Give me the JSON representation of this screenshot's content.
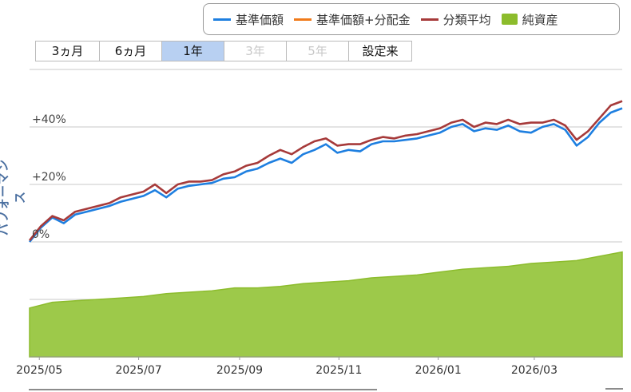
{
  "legend": {
    "items": [
      {
        "label": "基準価額",
        "color": "#1e7fe0",
        "kind": "line"
      },
      {
        "label": "基準価額+分配金",
        "color": "#f07a1a",
        "kind": "line"
      },
      {
        "label": "分類平均",
        "color": "#a63a3a",
        "kind": "line"
      },
      {
        "label": "純資産",
        "color": "#8cbc2c",
        "kind": "box"
      }
    ]
  },
  "range_buttons": [
    {
      "label": "3ヵ月",
      "state": "normal"
    },
    {
      "label": "6ヵ月",
      "state": "normal"
    },
    {
      "label": "1年",
      "state": "active"
    },
    {
      "label": "3年",
      "state": "disabled"
    },
    {
      "label": "5年",
      "state": "disabled"
    },
    {
      "label": "設定来",
      "state": "normal"
    }
  ],
  "y_axis_title": "パフォーマンス",
  "chart_data": {
    "type": "line",
    "x_start": "2025-04-25",
    "x_end": "2026-04-24",
    "x_ticks": [
      "2025/05",
      "2025/07",
      "2025/09",
      "2025/11",
      "2026/01",
      "2026/03"
    ],
    "y_ticks": [
      "0%",
      "+20%",
      "+40%"
    ],
    "ylim": [
      -40,
      60
    ],
    "grid": true,
    "series": [
      {
        "name": "基準価額",
        "color": "#1e7fe0",
        "x": [
          "2025-04-25",
          "2025-05-02",
          "2025-05-09",
          "2025-05-16",
          "2025-05-23",
          "2025-05-30",
          "2025-06-06",
          "2025-06-13",
          "2025-06-20",
          "2025-06-27",
          "2025-07-04",
          "2025-07-11",
          "2025-07-18",
          "2025-07-25",
          "2025-08-01",
          "2025-08-08",
          "2025-08-15",
          "2025-08-22",
          "2025-08-29",
          "2025-09-05",
          "2025-09-12",
          "2025-09-19",
          "2025-09-26",
          "2025-10-03",
          "2025-10-10",
          "2025-10-17",
          "2025-10-24",
          "2025-10-31",
          "2025-11-07",
          "2025-11-14",
          "2025-11-21",
          "2025-11-28",
          "2025-12-05",
          "2025-12-12",
          "2025-12-19",
          "2025-12-26",
          "2026-01-02",
          "2026-01-09",
          "2026-01-16",
          "2026-01-23",
          "2026-01-30",
          "2026-02-06",
          "2026-02-13",
          "2026-02-20",
          "2026-02-27",
          "2026-03-06",
          "2026-03-13",
          "2026-03-20",
          "2026-03-27",
          "2026-04-03",
          "2026-04-10",
          "2026-04-17",
          "2026-04-24"
        ],
        "y": [
          0.0,
          5.0,
          8.5,
          6.5,
          9.5,
          10.5,
          11.5,
          12.5,
          14.0,
          15.0,
          16.0,
          18.0,
          15.5,
          18.5,
          19.5,
          20.0,
          20.5,
          22.0,
          22.5,
          24.5,
          25.5,
          27.5,
          29.0,
          27.5,
          30.5,
          32.0,
          34.0,
          31.0,
          32.0,
          31.5,
          34.0,
          35.0,
          35.0,
          35.5,
          36.0,
          37.0,
          38.0,
          40.0,
          41.0,
          38.5,
          39.5,
          39.0,
          40.5,
          38.5,
          38.0,
          40.0,
          41.0,
          39.0,
          33.5,
          36.5,
          41.5,
          45.0,
          46.5
        ]
      },
      {
        "name": "分類平均",
        "color": "#a63a3a",
        "x": [
          "2025-04-25",
          "2025-05-02",
          "2025-05-09",
          "2025-05-16",
          "2025-05-23",
          "2025-05-30",
          "2025-06-06",
          "2025-06-13",
          "2025-06-20",
          "2025-06-27",
          "2025-07-04",
          "2025-07-11",
          "2025-07-18",
          "2025-07-25",
          "2025-08-01",
          "2025-08-08",
          "2025-08-15",
          "2025-08-22",
          "2025-08-29",
          "2025-09-05",
          "2025-09-12",
          "2025-09-19",
          "2025-09-26",
          "2025-10-03",
          "2025-10-10",
          "2025-10-17",
          "2025-10-24",
          "2025-10-31",
          "2025-11-07",
          "2025-11-14",
          "2025-11-21",
          "2025-11-28",
          "2025-12-05",
          "2025-12-12",
          "2025-12-19",
          "2025-12-26",
          "2026-01-02",
          "2026-01-09",
          "2026-01-16",
          "2026-01-23",
          "2026-01-30",
          "2026-02-06",
          "2026-02-13",
          "2026-02-20",
          "2026-02-27",
          "2026-03-06",
          "2026-03-13",
          "2026-03-20",
          "2026-03-27",
          "2026-04-03",
          "2026-04-10",
          "2026-04-17",
          "2026-04-24"
        ],
        "y": [
          0.5,
          5.5,
          9.0,
          7.5,
          10.5,
          11.5,
          12.5,
          13.5,
          15.5,
          16.5,
          17.5,
          20.0,
          17.0,
          20.0,
          21.0,
          21.0,
          21.5,
          23.5,
          24.5,
          26.5,
          27.5,
          30.0,
          32.0,
          30.5,
          33.0,
          35.0,
          36.0,
          33.5,
          34.0,
          34.0,
          35.5,
          36.5,
          36.0,
          37.0,
          37.5,
          38.5,
          39.5,
          41.5,
          42.5,
          40.0,
          41.5,
          41.0,
          42.5,
          41.0,
          41.5,
          41.5,
          42.5,
          40.5,
          35.5,
          38.5,
          43.0,
          47.5,
          49.0
        ]
      },
      {
        "name": "純資産",
        "color": "#8cbc2c",
        "kind": "area",
        "x": [
          "2025-04-25",
          "2025-05-09",
          "2025-05-23",
          "2025-06-06",
          "2025-06-20",
          "2025-07-04",
          "2025-07-18",
          "2025-08-01",
          "2025-08-15",
          "2025-08-29",
          "2025-09-12",
          "2025-09-26",
          "2025-10-10",
          "2025-10-24",
          "2025-11-07",
          "2025-11-21",
          "2025-12-05",
          "2025-12-19",
          "2026-01-02",
          "2026-01-16",
          "2026-01-30",
          "2026-02-13",
          "2026-02-27",
          "2026-03-13",
          "2026-03-27",
          "2026-04-10",
          "2026-04-24"
        ],
        "y": [
          -23.0,
          -21.0,
          -20.5,
          -20.0,
          -19.5,
          -19.0,
          -18.0,
          -17.5,
          -17.0,
          -16.0,
          -16.0,
          -15.5,
          -14.5,
          -14.0,
          -13.5,
          -12.5,
          -12.0,
          -11.5,
          -10.5,
          -9.5,
          -9.0,
          -8.5,
          -7.5,
          -7.0,
          -6.5,
          -5.0,
          -3.5
        ]
      }
    ]
  }
}
